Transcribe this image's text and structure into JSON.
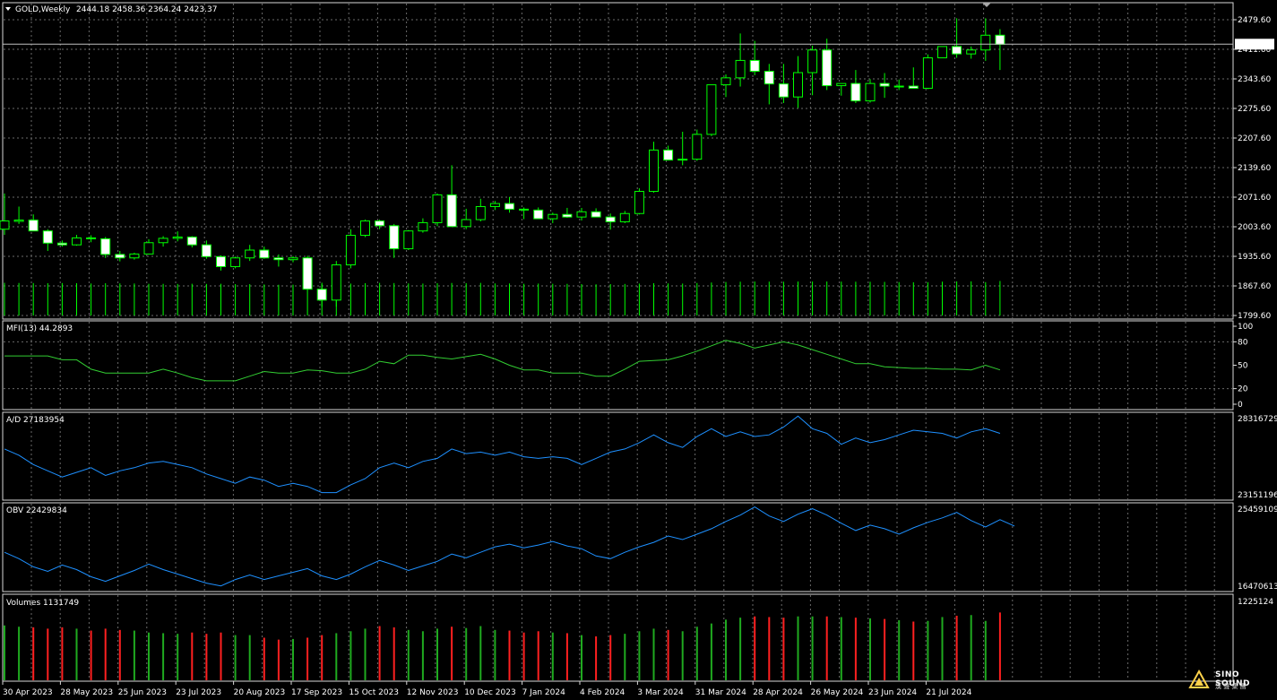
{
  "header": {
    "symbol": "GOLD,Weekly",
    "ohlc": "2444.18 2458.36 2364.24 2423.37",
    "current_price": "2423.37"
  },
  "colors": {
    "background": "#000000",
    "grid": "#6a6a6a",
    "candle_line": "#00ff00",
    "bull_body": "#000000",
    "bear_body": "#ffffff",
    "mfi_line": "#32cd32",
    "ad_line": "#1e90ff",
    "obv_line": "#1e90ff",
    "vol_up": "#1faa1f",
    "vol_down": "#ff2020",
    "bid_line": "#c0c0c0"
  },
  "watermark": {
    "text": "SINO SOUND",
    "sub": "漢 聲 集 團"
  },
  "chart_data": [
    {
      "type": "candlestick",
      "title": "GOLD,Weekly",
      "y_ticks": [
        "2479.60",
        "2411.60",
        "2343.60",
        "2275.60",
        "2207.60",
        "2139.60",
        "2071.60",
        "2003.60",
        "1935.60",
        "1867.60",
        "1799.60"
      ],
      "ylim": [
        1799.6,
        2479.6
      ],
      "x_ticks": [
        "30 Apr 2023",
        "28 May 2023",
        "25 Jun 2023",
        "23 Jul 2023",
        "20 Aug 2023",
        "17 Sep 2023",
        "15 Oct 2023",
        "12 Nov 2023",
        "10 Dec 2023",
        "7 Jan 2024",
        "4 Feb 2024",
        "3 Mar 2024",
        "31 Mar 2024",
        "28 Apr 2024",
        "26 May 2024",
        "23 Jun 2024",
        "21 Jul 2024"
      ],
      "candles": [
        [
          1998,
          2080,
          1985,
          2017
        ],
        [
          2016,
          2050,
          2010,
          2019
        ],
        [
          2019,
          2032,
          1994,
          1994
        ],
        [
          1994,
          1998,
          1948,
          1966
        ],
        [
          1966,
          1972,
          1958,
          1962
        ],
        [
          1962,
          1985,
          1960,
          1978
        ],
        [
          1978,
          1984,
          1968,
          1976
        ],
        [
          1976,
          1980,
          1932,
          1940
        ],
        [
          1940,
          1948,
          1924,
          1932
        ],
        [
          1932,
          1944,
          1928,
          1941
        ],
        [
          1941,
          1975,
          1940,
          1967
        ],
        [
          1967,
          1982,
          1958,
          1977
        ],
        [
          1977,
          1993,
          1970,
          1980
        ],
        [
          1980,
          1982,
          1956,
          1962
        ],
        [
          1962,
          1972,
          1930,
          1935
        ],
        [
          1935,
          1938,
          1903,
          1912
        ],
        [
          1912,
          1935,
          1908,
          1932
        ],
        [
          1932,
          1962,
          1925,
          1950
        ],
        [
          1950,
          1958,
          1930,
          1932
        ],
        [
          1932,
          1940,
          1912,
          1928
        ],
        [
          1928,
          1936,
          1922,
          1932
        ],
        [
          1932,
          1937,
          1870,
          1860
        ],
        [
          1860,
          1875,
          1820,
          1835
        ],
        [
          1835,
          1925,
          1820,
          1916
        ],
        [
          1916,
          1998,
          1908,
          1984
        ],
        [
          1984,
          2020,
          1980,
          2017
        ],
        [
          2017,
          2020,
          1998,
          2006
        ],
        [
          2006,
          2010,
          1932,
          1953
        ],
        [
          1953,
          1996,
          1950,
          1994
        ],
        [
          1994,
          2023,
          1990,
          2013
        ],
        [
          2013,
          2080,
          2005,
          2077
        ],
        [
          2077,
          2145,
          2004,
          2004
        ],
        [
          2004,
          2045,
          1998,
          2020
        ],
        [
          2020,
          2068,
          2016,
          2050
        ],
        [
          2050,
          2063,
          2042,
          2057
        ],
        [
          2057,
          2072,
          2036,
          2044
        ],
        [
          2044,
          2048,
          2021,
          2042
        ],
        [
          2042,
          2048,
          2022,
          2022
        ],
        [
          2022,
          2036,
          2012,
          2032
        ],
        [
          2032,
          2047,
          2024,
          2026
        ],
        [
          2026,
          2047,
          2018,
          2038
        ],
        [
          2038,
          2046,
          2026,
          2026
        ],
        [
          2026,
          2034,
          1997,
          2015
        ],
        [
          2015,
          2040,
          2012,
          2034
        ],
        [
          2034,
          2092,
          2032,
          2085
        ],
        [
          2085,
          2199,
          2082,
          2180
        ],
        [
          2180,
          2190,
          2161,
          2157
        ],
        [
          2157,
          2222,
          2145,
          2159
        ],
        [
          2159,
          2227,
          2155,
          2216
        ],
        [
          2216,
          2328,
          2212,
          2330
        ],
        [
          2330,
          2354,
          2302,
          2346
        ],
        [
          2346,
          2448,
          2326,
          2386
        ],
        [
          2386,
          2431,
          2352,
          2361
        ],
        [
          2361,
          2378,
          2285,
          2332
        ],
        [
          2332,
          2378,
          2288,
          2302
        ],
        [
          2302,
          2396,
          2277,
          2358
        ],
        [
          2358,
          2420,
          2306,
          2410
        ],
        [
          2410,
          2436,
          2318,
          2328
        ],
        [
          2328,
          2330,
          2305,
          2333
        ],
        [
          2333,
          2364,
          2288,
          2293
        ],
        [
          2293,
          2343,
          2289,
          2333
        ],
        [
          2333,
          2357,
          2300,
          2327
        ],
        [
          2327,
          2342,
          2318,
          2327
        ],
        [
          2327,
          2370,
          2322,
          2322
        ],
        [
          2322,
          2400,
          2320,
          2392
        ],
        [
          2392,
          2405,
          2392,
          2418
        ],
        [
          2418,
          2483,
          2392,
          2401
        ],
        [
          2401,
          2418,
          2390,
          2410
        ],
        [
          2410,
          2483,
          2385,
          2444
        ],
        [
          2444,
          2458,
          2364,
          2423
        ]
      ]
    },
    {
      "type": "line",
      "name": "MFI(13) 44.2893",
      "ylim": [
        0,
        100
      ],
      "y_ticks": [
        "100",
        "80",
        "50",
        "20",
        "0"
      ],
      "values": [
        62,
        62,
        62,
        62,
        57,
        57,
        45,
        40,
        40,
        40,
        40,
        45,
        40,
        34,
        30,
        30,
        30,
        36,
        42,
        40,
        40,
        44,
        43,
        40,
        40,
        45,
        55,
        52,
        63,
        63,
        60,
        58,
        61,
        64,
        58,
        50,
        44,
        44,
        40,
        40,
        40,
        36,
        36,
        45,
        55,
        56,
        57,
        62,
        68,
        75,
        82,
        78,
        72,
        76,
        80,
        76,
        70,
        64,
        58,
        52,
        52,
        48,
        47,
        46,
        46,
        45,
        45,
        44,
        50,
        44
      ]
    },
    {
      "type": "line",
      "name": "A/D 27183954",
      "y_ticks": [
        "28316729",
        "23151196"
      ],
      "values": [
        26.2,
        25.8,
        25.2,
        24.8,
        24.4,
        24.7,
        25.0,
        24.5,
        24.8,
        25.0,
        25.3,
        25.4,
        25.2,
        25.0,
        24.6,
        24.3,
        24.0,
        24.4,
        24.2,
        23.8,
        24.0,
        23.8,
        23.4,
        23.4,
        23.9,
        24.3,
        25.0,
        25.3,
        25.0,
        25.4,
        25.6,
        26.2,
        25.9,
        26.0,
        25.8,
        26.0,
        25.7,
        25.6,
        25.7,
        25.6,
        25.2,
        25.6,
        26.0,
        26.2,
        26.6,
        27.1,
        26.6,
        26.3,
        27.0,
        27.5,
        27.0,
        27.3,
        27.0,
        27.1,
        27.6,
        28.3,
        27.5,
        27.2,
        26.5,
        26.9,
        26.6,
        26.8,
        27.1,
        27.4,
        27.3,
        27.2,
        26.9,
        27.3,
        27.5,
        27.2
      ]
    },
    {
      "type": "line",
      "name": "OBV 22429834",
      "y_ticks": [
        "25459109",
        "16470613"
      ],
      "values": [
        20.4,
        19.7,
        18.8,
        18.3,
        19.0,
        18.5,
        17.7,
        17.2,
        17.8,
        18.4,
        19.1,
        18.5,
        18.0,
        17.5,
        17.0,
        16.7,
        17.4,
        17.9,
        17.4,
        17.8,
        18.2,
        18.6,
        17.8,
        17.4,
        18.0,
        18.8,
        19.5,
        19.0,
        18.4,
        18.9,
        19.4,
        20.2,
        19.8,
        20.4,
        21.0,
        21.3,
        20.9,
        21.2,
        21.6,
        21.1,
        20.8,
        20.0,
        19.7,
        20.4,
        21.0,
        21.5,
        22.2,
        21.8,
        22.4,
        23.0,
        23.8,
        24.5,
        25.4,
        24.4,
        23.8,
        24.6,
        25.2,
        24.5,
        23.6,
        22.8,
        23.4,
        23.0,
        22.4,
        23.1,
        23.7,
        24.2,
        24.8,
        23.9,
        23.2,
        24.0,
        23.3
      ]
    },
    {
      "type": "bar",
      "name": "Volumes 1131749",
      "y_ticks": [
        "1225124"
      ],
      "values": [
        0.85,
        0.83,
        0.82,
        0.8,
        0.82,
        0.8,
        0.77,
        0.8,
        0.78,
        0.77,
        0.74,
        0.73,
        0.72,
        0.74,
        0.72,
        0.74,
        0.7,
        0.7,
        0.66,
        0.63,
        0.64,
        0.66,
        0.7,
        0.73,
        0.76,
        0.8,
        0.84,
        0.82,
        0.78,
        0.76,
        0.8,
        0.83,
        0.81,
        0.84,
        0.78,
        0.77,
        0.74,
        0.76,
        0.74,
        0.73,
        0.7,
        0.68,
        0.7,
        0.72,
        0.76,
        0.8,
        0.78,
        0.76,
        0.83,
        0.88,
        0.94,
        0.97,
        0.99,
        0.98,
        0.97,
        0.99,
        0.99,
        0.99,
        0.98,
        0.97,
        0.96,
        0.95,
        0.93,
        0.91,
        0.92,
        0.98,
        1.0,
        1.01,
        0.92,
        1.05
      ]
    }
  ]
}
